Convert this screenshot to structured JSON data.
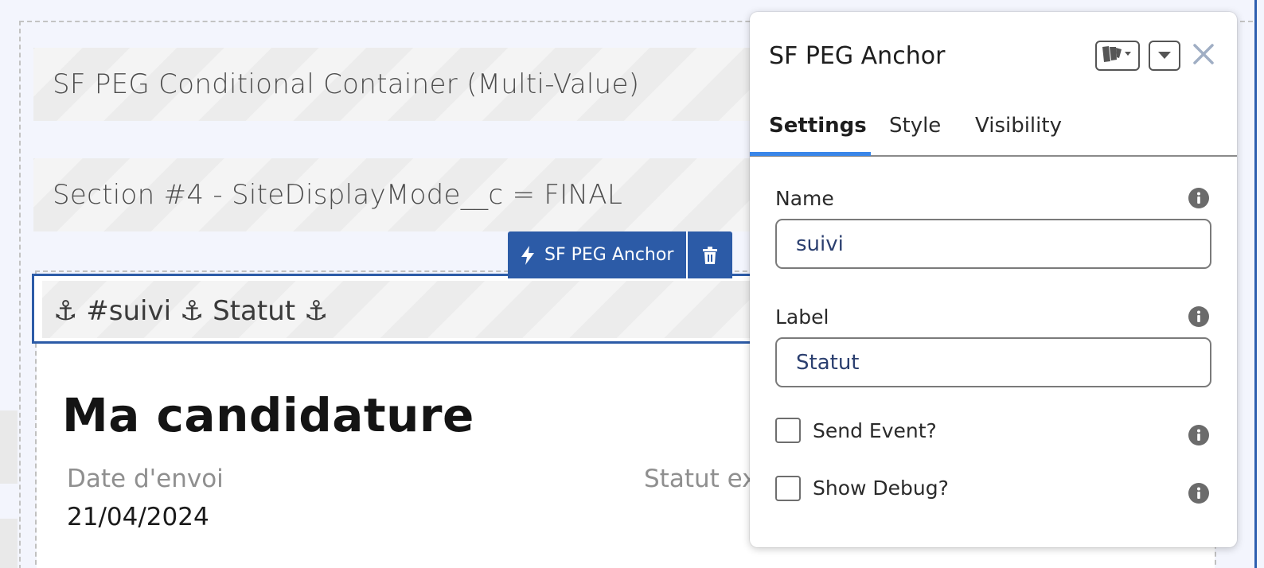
{
  "canvas": {
    "conditional_container_label": "SF PEG Conditional Container (Multi-Value)",
    "section_label": "Section #4 - SiteDisplayMode__c = FINAL",
    "anchor_block_label": "⚓ #suivi ⚓ Statut ⚓",
    "anchor_toolbar": {
      "block_name": "SF PEG Anchor",
      "lightning_icon": "lightning-bolt-icon",
      "delete_icon": "trash-icon"
    },
    "page_heading": "Ma candidature",
    "fields": [
      {
        "label": "Date d'envoi",
        "value": "21/04/2024"
      },
      {
        "label": "Statut ex",
        "value": ""
      }
    ]
  },
  "panel": {
    "title": "SF PEG Anchor",
    "header_icons": [
      "block-variations-icon",
      "chevron-down-icon",
      "close-icon"
    ],
    "tabs": [
      {
        "label": "Settings",
        "active": true
      },
      {
        "label": "Style",
        "active": false
      },
      {
        "label": "Visibility",
        "active": false
      }
    ],
    "name_field": {
      "label": "Name",
      "value": "suivi"
    },
    "label_field": {
      "label": "Label",
      "value": "Statut"
    },
    "send_event": {
      "label": "Send Event?",
      "checked": false
    },
    "show_debug": {
      "label": "Show Debug?",
      "checked": false
    }
  },
  "colors": {
    "accent": "#2c5ba7",
    "tab_underline": "#3a86e8",
    "input_text": "#2b3f6f",
    "canvas_bg": "#f3f5fd"
  }
}
